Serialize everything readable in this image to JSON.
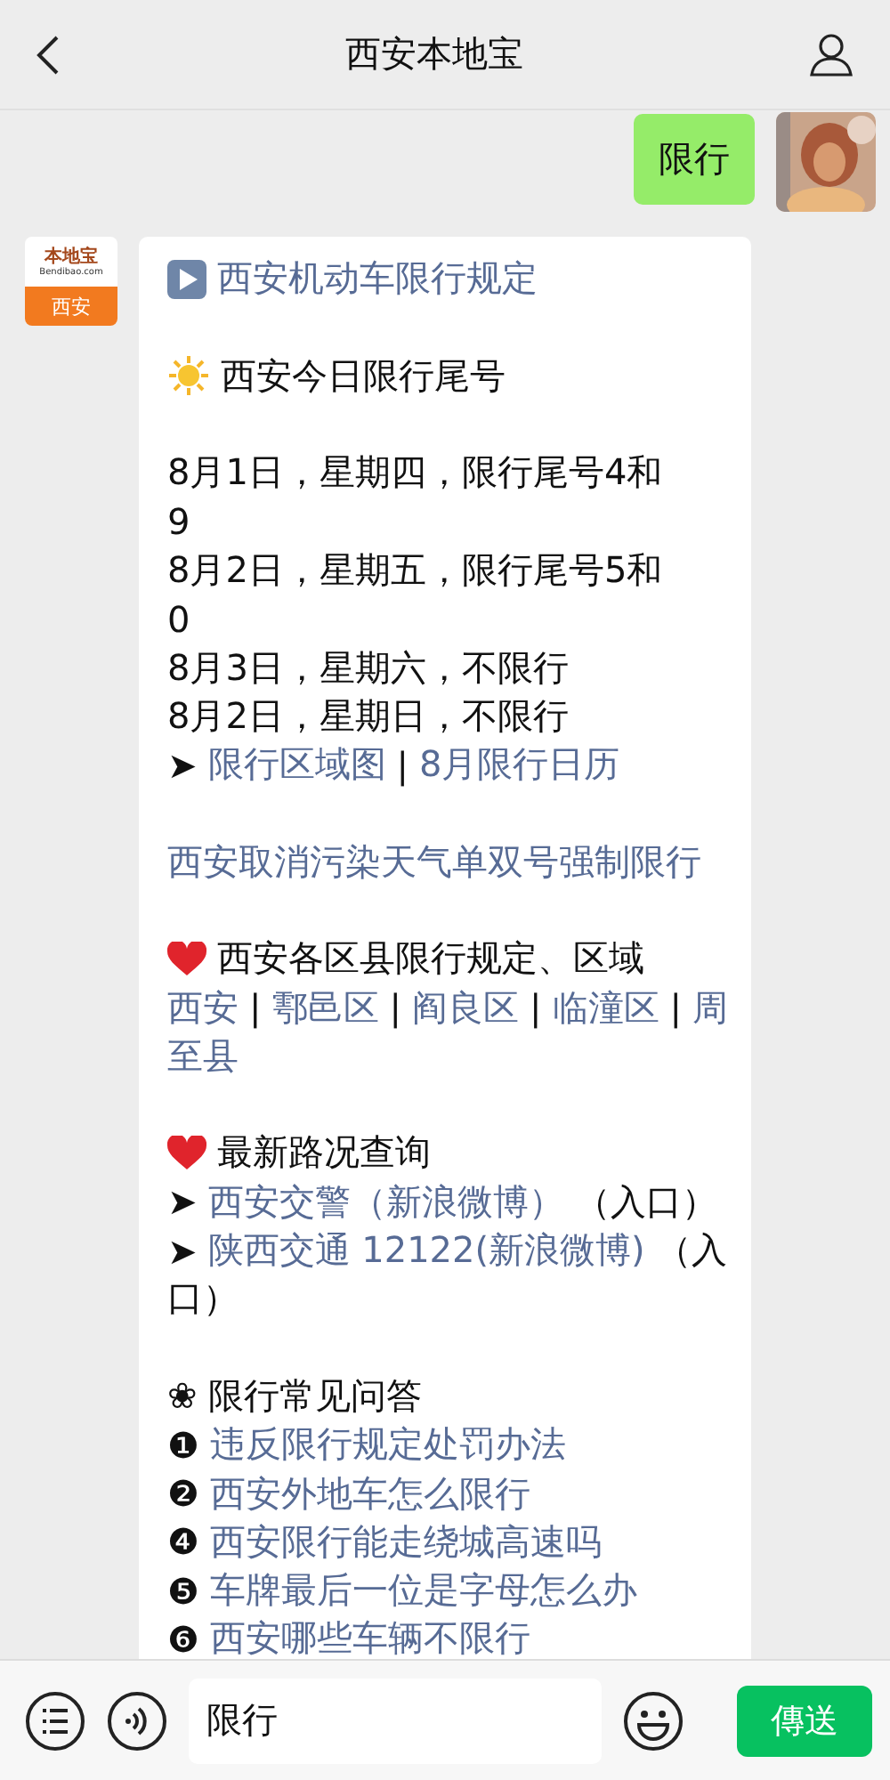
{
  "header": {
    "title": "西安本地宝"
  },
  "outgoing": {
    "text": "限行"
  },
  "incoming": {
    "logo": {
      "brand": "本地宝",
      "site": "Bendibao.com",
      "city": "西安"
    },
    "lines": [
      {
        "kind": "play",
        "segments": [
          {
            "text": "西安机动车限行规定",
            "link": true
          }
        ]
      },
      {
        "kind": "blank"
      },
      {
        "kind": "sun",
        "segments": [
          {
            "text": "西安今日限行尾号",
            "link": false
          }
        ]
      },
      {
        "kind": "blank"
      },
      {
        "kind": "text",
        "segments": [
          {
            "text": "8月1日，星期四，限行尾号4和",
            "link": false
          }
        ]
      },
      {
        "kind": "text",
        "segments": [
          {
            "text": "9",
            "link": false
          }
        ]
      },
      {
        "kind": "text",
        "segments": [
          {
            "text": "8月2日，星期五，限行尾号5和",
            "link": false
          }
        ]
      },
      {
        "kind": "text",
        "segments": [
          {
            "text": "0",
            "link": false
          }
        ]
      },
      {
        "kind": "text",
        "segments": [
          {
            "text": "8月3日，星期六，不限行",
            "link": false
          }
        ]
      },
      {
        "kind": "text",
        "segments": [
          {
            "text": "8月2日，星期日，不限行",
            "link": false
          }
        ]
      },
      {
        "kind": "text",
        "segments": [
          {
            "text": "➤",
            "link": false
          },
          {
            "text": "限行区域图",
            "link": true
          },
          {
            "text": "|",
            "link": false
          },
          {
            "text": "8月限行日历",
            "link": true
          }
        ]
      },
      {
        "kind": "blank"
      },
      {
        "kind": "text",
        "segments": [
          {
            "text": "西安取消污染天气单双号强制限行",
            "link": true
          }
        ]
      },
      {
        "kind": "blank"
      },
      {
        "kind": "heart",
        "segments": [
          {
            "text": "西安各区县限行规定、区域",
            "link": false
          }
        ]
      },
      {
        "kind": "text",
        "segments": [
          {
            "text": "西安",
            "link": true
          },
          {
            "text": "|",
            "link": false
          },
          {
            "text": "鄠邑区",
            "link": true
          },
          {
            "text": "|",
            "link": false
          },
          {
            "text": "阎良区",
            "link": true
          },
          {
            "text": "|",
            "link": false
          },
          {
            "text": "临潼区",
            "link": true
          },
          {
            "text": "|",
            "link": false
          },
          {
            "text": "周",
            "link": true
          }
        ]
      },
      {
        "kind": "text",
        "segments": [
          {
            "text": "至县",
            "link": true
          }
        ]
      },
      {
        "kind": "blank"
      },
      {
        "kind": "heart",
        "segments": [
          {
            "text": "最新路况查询",
            "link": false
          }
        ]
      },
      {
        "kind": "text",
        "segments": [
          {
            "text": "➤",
            "link": false
          },
          {
            "text": "西安交警（新浪微博）",
            "link": true
          },
          {
            "text": "（入口）",
            "link": false
          }
        ]
      },
      {
        "kind": "text",
        "segments": [
          {
            "text": "➤",
            "link": false
          },
          {
            "text": "陕西交通 12122(新浪微博)",
            "link": true
          },
          {
            "text": "（入",
            "link": false
          }
        ]
      },
      {
        "kind": "text",
        "segments": [
          {
            "text": "口）",
            "link": false
          }
        ]
      },
      {
        "kind": "blank"
      },
      {
        "kind": "text",
        "segments": [
          {
            "text": "❀",
            "link": false
          },
          {
            "text": "限行常见问答",
            "link": false
          }
        ]
      },
      {
        "kind": "text",
        "segments": [
          {
            "text": "❶",
            "link": false
          },
          {
            "text": "违反限行规定处罚办法",
            "link": true
          }
        ]
      },
      {
        "kind": "text",
        "segments": [
          {
            "text": "❷",
            "link": false
          },
          {
            "text": "西安外地车怎么限行",
            "link": true
          }
        ]
      },
      {
        "kind": "text",
        "segments": [
          {
            "text": "❹",
            "link": false
          },
          {
            "text": "西安限行能走绕城高速吗",
            "link": true
          }
        ]
      },
      {
        "kind": "text",
        "segments": [
          {
            "text": "❺",
            "link": false
          },
          {
            "text": "车牌最后一位是字母怎么办",
            "link": true
          }
        ]
      },
      {
        "kind": "text",
        "segments": [
          {
            "text": "❻",
            "link": false
          },
          {
            "text": "西安哪些车辆不限行",
            "link": true
          }
        ]
      }
    ]
  },
  "composer": {
    "value": "限行",
    "send_label": "傳送"
  }
}
